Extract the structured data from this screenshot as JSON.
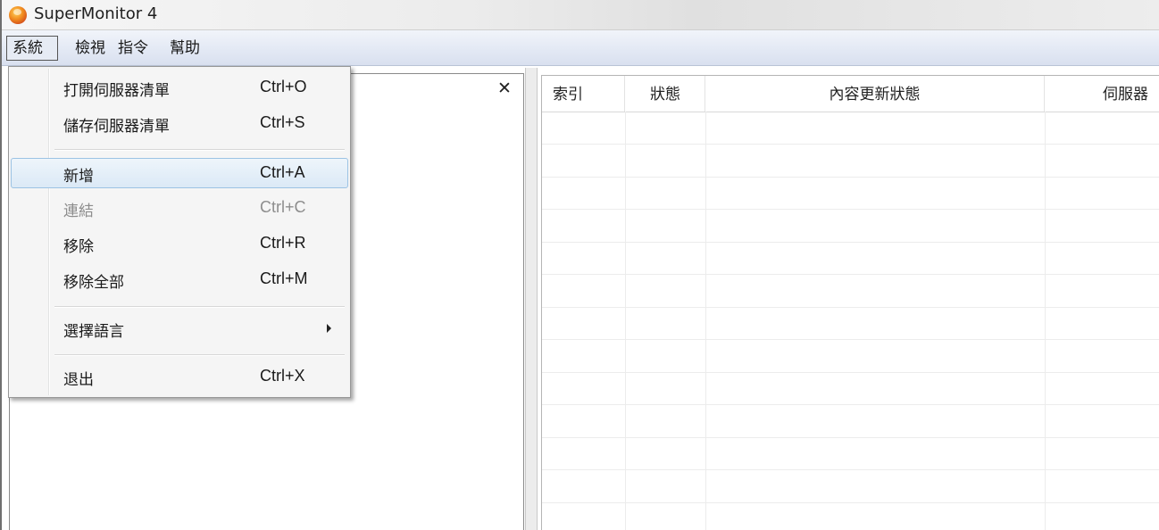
{
  "window": {
    "title": "SuperMonitor 4",
    "icon": "app-logo-icon"
  },
  "menubar": {
    "system": "系統",
    "view": "檢視",
    "command": "指令",
    "help": "幫助"
  },
  "left_pane": {
    "close_glyph": "✕"
  },
  "table": {
    "headers": {
      "index": "索引",
      "status": "狀態",
      "update_status": "內容更新狀態",
      "server": "伺服器"
    },
    "rows": []
  },
  "dropdown": {
    "items": [
      {
        "label": "打開伺服器清單",
        "shortcut": "Ctrl+O",
        "enabled": true
      },
      {
        "label": "儲存伺服器清單",
        "shortcut": "Ctrl+S",
        "enabled": true
      },
      {
        "label": "新增",
        "shortcut": "Ctrl+A",
        "enabled": true,
        "highlighted": true
      },
      {
        "label": "連結",
        "shortcut": "Ctrl+C",
        "enabled": false
      },
      {
        "label": "移除",
        "shortcut": "Ctrl+R",
        "enabled": true
      },
      {
        "label": "移除全部",
        "shortcut": "Ctrl+M",
        "enabled": true
      },
      {
        "label": "選擇語言",
        "shortcut": "",
        "enabled": true,
        "submenu": true
      },
      {
        "label": "退出",
        "shortcut": "Ctrl+X",
        "enabled": true
      }
    ]
  },
  "colors": {
    "highlight": "#dbe9f6",
    "highlight_border": "#9cc3e4",
    "disabled_text": "#8d8d8d"
  }
}
